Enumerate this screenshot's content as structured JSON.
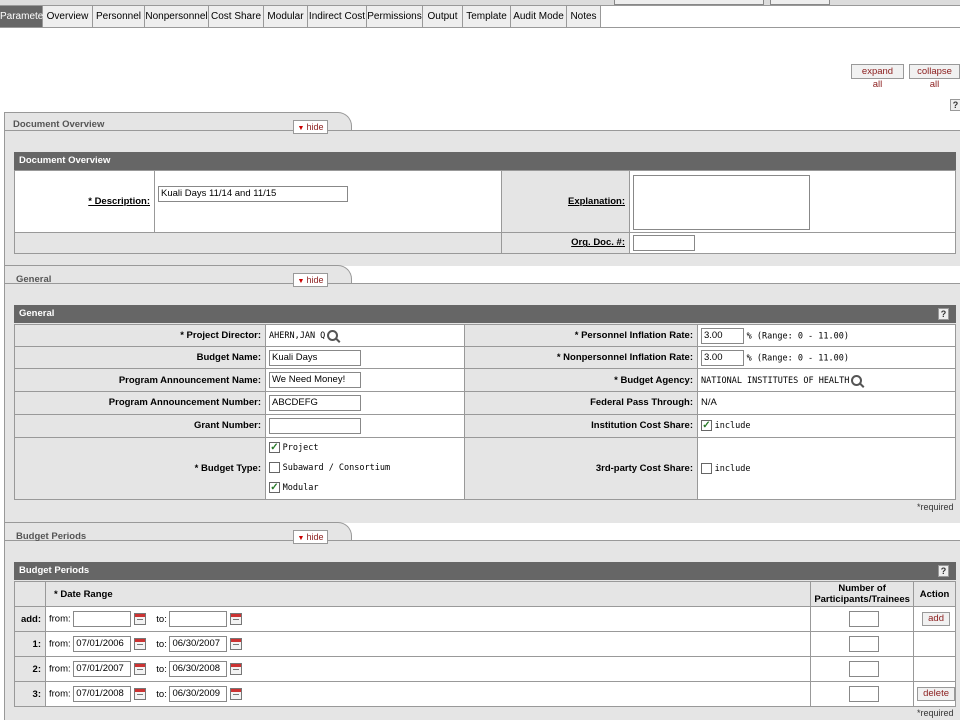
{
  "tabs": [
    "Parameters",
    "Overview",
    "Personnel",
    "Nonpersonnel",
    "Cost Share",
    "Modular",
    "Indirect Cost",
    "Permissions",
    "Output",
    "Template",
    "Audit Mode",
    "Notes"
  ],
  "active_tab": "Parameters",
  "controls": {
    "expand_all": "expand all",
    "collapse_all": "collapse all",
    "help": "?"
  },
  "document_overview": {
    "tab_title": "Document Overview",
    "hide_label": "hide",
    "header": "Document Overview",
    "description_label": "* Description:",
    "description_value": "Kuali Days 11/14 and 11/15",
    "explanation_label": "Explanation:",
    "explanation_value": "",
    "org_doc_label": "Org. Doc. #:",
    "org_doc_value": ""
  },
  "general": {
    "tab_title": "General",
    "hide_label": "hide",
    "header": "General",
    "project_director_label": "* Project Director:",
    "project_director_value": "AHERN,JAN Q",
    "budget_name_label": "Budget Name:",
    "budget_name_value": "Kuali Days",
    "program_announcement_name_label": "Program Announcement Name:",
    "program_announcement_name_value": "We Need Money!",
    "program_announcement_number_label": "Program Announcement Number:",
    "program_announcement_number_value": "ABCDEFG",
    "grant_number_label": "Grant Number:",
    "grant_number_value": "",
    "budget_type_label": "* Budget Type:",
    "budget_types": [
      {
        "label": "Project",
        "checked": true
      },
      {
        "label": "Subaward / Consortium",
        "checked": false
      },
      {
        "label": "Modular",
        "checked": true
      }
    ],
    "personnel_inflation_label": "* Personnel Inflation Rate:",
    "personnel_inflation_value": "3.00",
    "personnel_inflation_range": "% (Range: 0 - 11.00)",
    "nonpersonnel_inflation_label": "* Nonpersonnel Inflation Rate:",
    "nonpersonnel_inflation_value": "3.00",
    "nonpersonnel_inflation_range": "% (Range: 0 - 11.00)",
    "budget_agency_label": "* Budget Agency:",
    "budget_agency_value": "NATIONAL INSTITUTES OF HEALTH",
    "federal_pass_label": "Federal Pass Through:",
    "federal_pass_value": "N/A",
    "institution_cost_share_label": "Institution Cost Share:",
    "institution_cost_share_text": "include",
    "institution_cost_share_checked": true,
    "third_party_cost_share_label": "3rd-party Cost Share:",
    "third_party_cost_share_text": "include",
    "third_party_cost_share_checked": false,
    "required_note": "*required"
  },
  "budget_periods": {
    "tab_title": "Budget Periods",
    "hide_label": "hide",
    "header": "Budget Periods",
    "date_range_header": "* Date Range",
    "participants_header_1": "Number of",
    "participants_header_2": "Participants/Trainees",
    "action_header": "Action",
    "from_label": "from:",
    "to_label": "to:",
    "rows": [
      {
        "row_label": "add:",
        "from": "",
        "to": "",
        "participants": "",
        "action": "add"
      },
      {
        "row_label": "1:",
        "from": "07/01/2006",
        "to": "06/30/2007",
        "participants": "",
        "action": ""
      },
      {
        "row_label": "2:",
        "from": "07/01/2007",
        "to": "06/30/2008",
        "participants": "",
        "action": ""
      },
      {
        "row_label": "3:",
        "from": "07/01/2008",
        "to": "06/30/2009",
        "participants": "",
        "action": "delete"
      }
    ],
    "required_note": "*required"
  }
}
